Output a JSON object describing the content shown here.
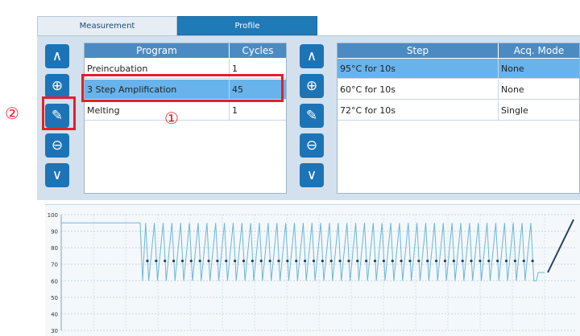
{
  "tabs": [
    "Measurement",
    "Profile"
  ],
  "program_table": {
    "headers": [
      "Program",
      "Cycles"
    ],
    "rows": [
      {
        "program": "Preincubation",
        "cycles": "1"
      },
      {
        "program": "3 Step Amplification",
        "cycles": "45"
      },
      {
        "program": "Melting",
        "cycles": "1"
      }
    ],
    "selected_row": 1
  },
  "step_table": {
    "headers": [
      "Step",
      "Acq. Mode"
    ],
    "rows": [
      {
        "step": "95°C for 10s",
        "mode": "None"
      },
      {
        "step": "60°C for 10s",
        "mode": "None"
      },
      {
        "step": "72°C for 10s",
        "mode": "Single"
      }
    ],
    "selected_row": 0
  },
  "buttons": {
    "up": "∧",
    "add": "⊕",
    "edit": "✎",
    "remove": "⊖",
    "down": "∨"
  },
  "callouts": [
    "①",
    "②"
  ],
  "colors": {
    "accent": "#1c74b6",
    "header": "#4a8bc4",
    "selected": "#68b3ec",
    "highlight": "#e3202a",
    "curve": "#6cb6d8",
    "marker": "#2a3f5e"
  },
  "chart_data": {
    "type": "line",
    "yticks": [
      "100",
      "90",
      "80",
      "70",
      "60",
      "50",
      "40",
      "30"
    ],
    "ylim": [
      30,
      100
    ],
    "grid": true,
    "series": [
      {
        "values_description": "temperature profile",
        "segments": {
          "preincubation": 95,
          "cycle_high": 95,
          "cycle_low": 60,
          "acquisition_marker": 72,
          "cycles_drawn": 45,
          "melting_start": 65,
          "melting_end": 97
        }
      }
    ]
  }
}
